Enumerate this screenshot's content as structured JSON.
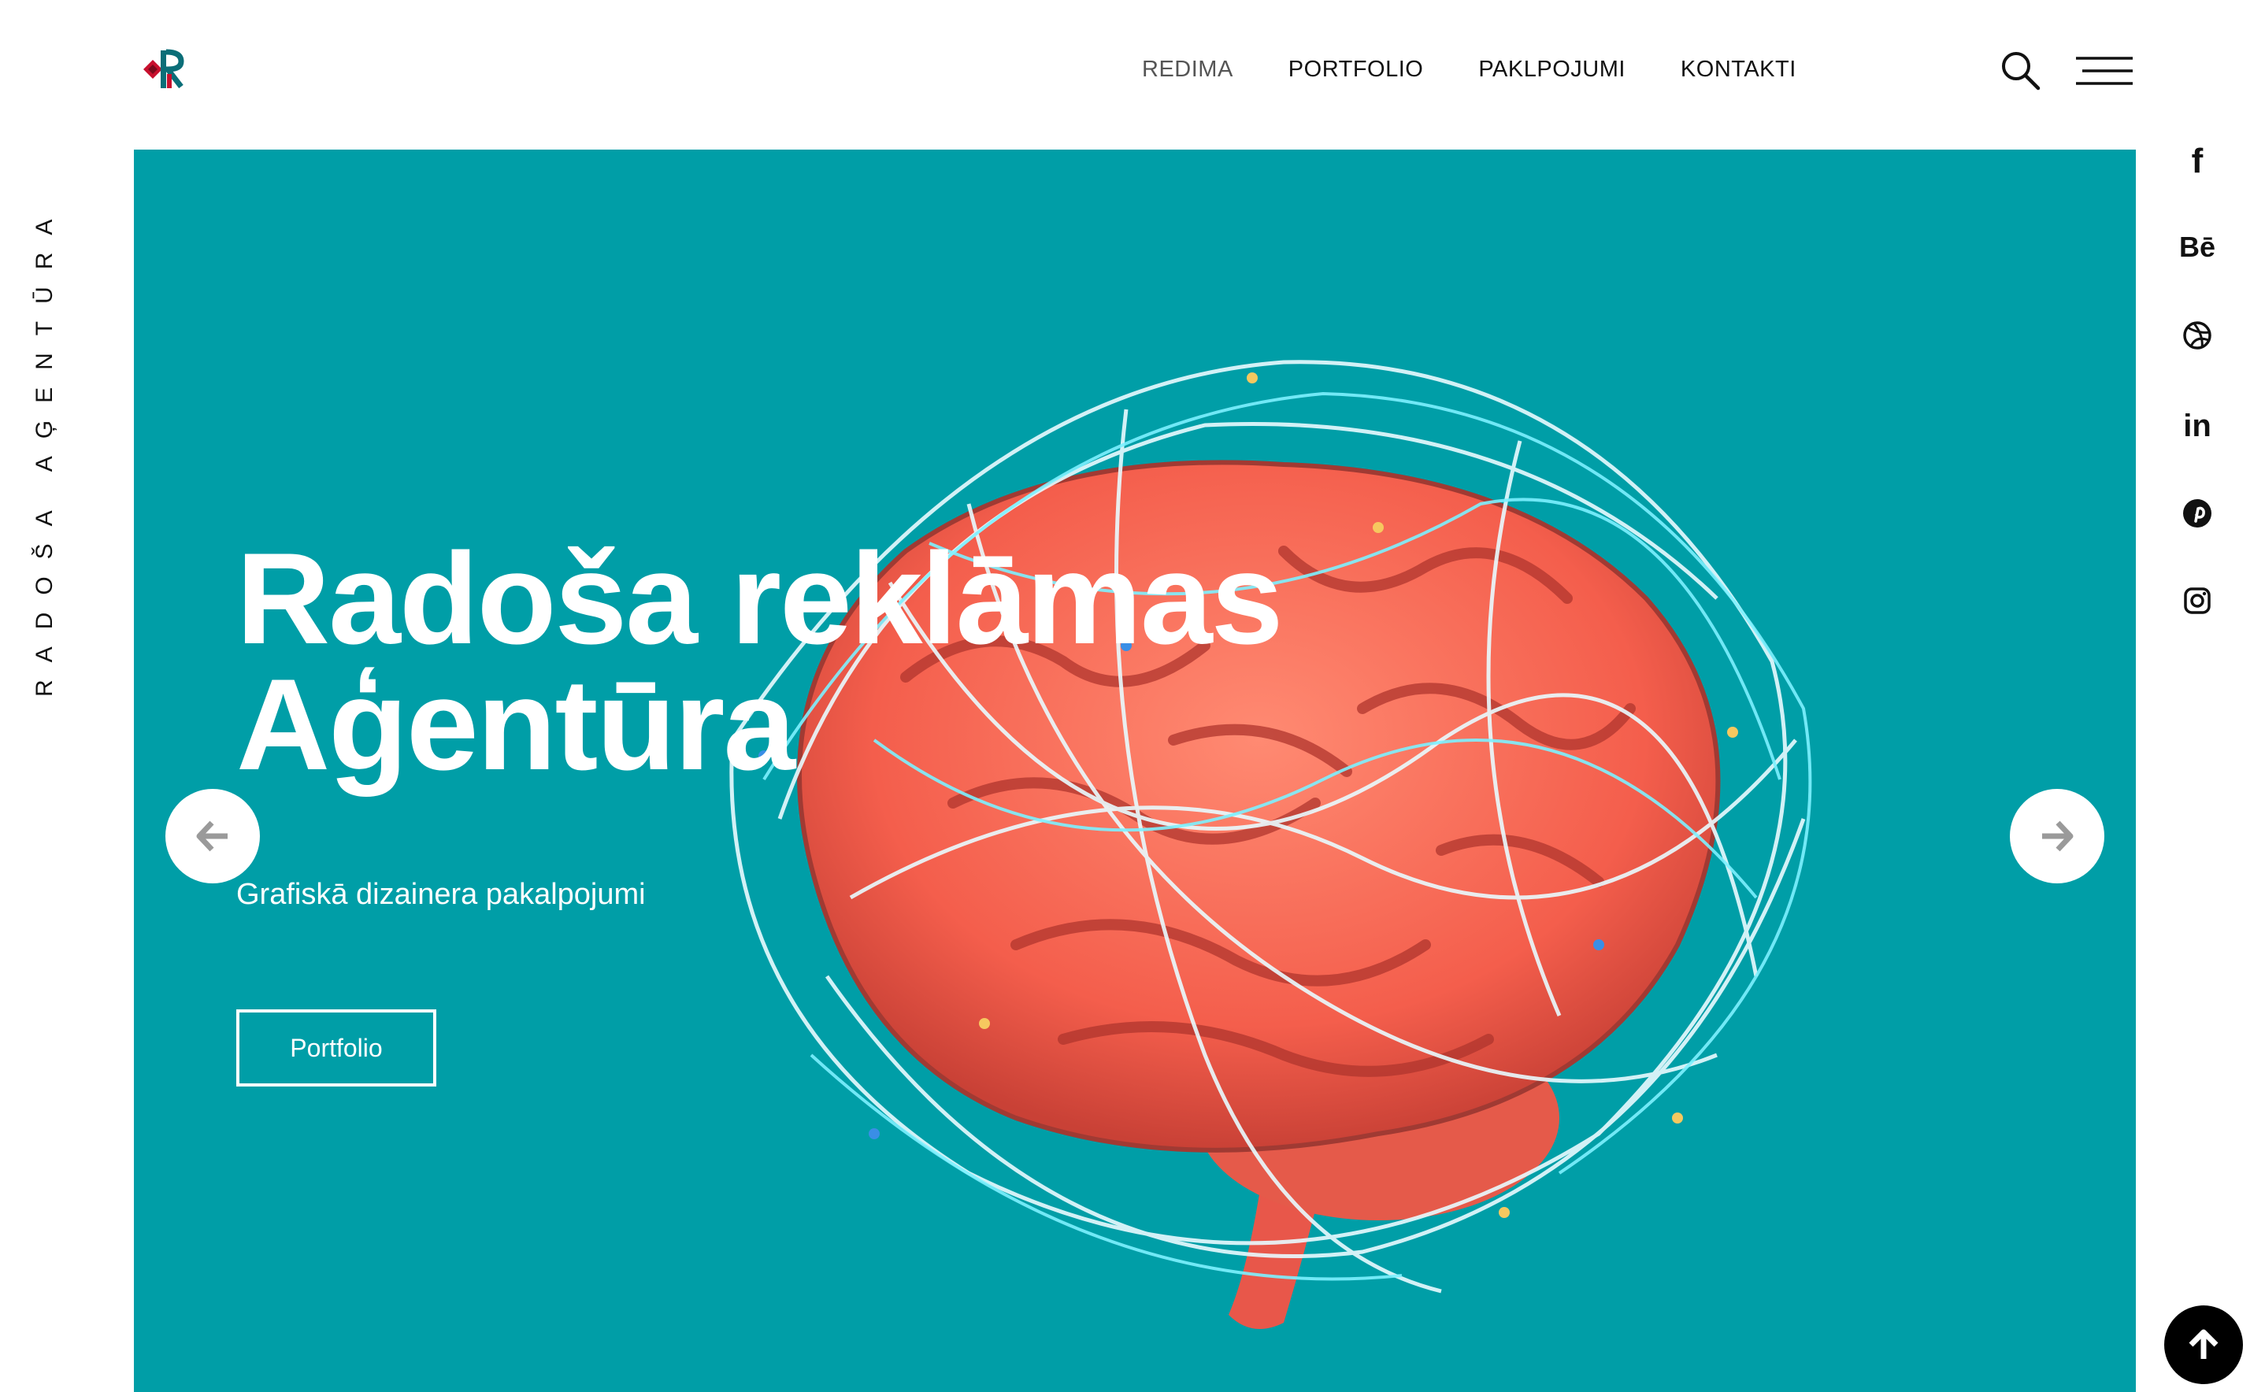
{
  "header": {
    "logo_alt": "R logo",
    "nav": [
      {
        "label": "REDIMA",
        "active": true
      },
      {
        "label": "PORTFOLIO"
      },
      {
        "label": "PAKLPOJUMI"
      },
      {
        "label": "KONTAKTI"
      }
    ],
    "search_icon": "search-icon",
    "menu_icon": "hamburger-menu-icon"
  },
  "sidebar": {
    "vertical_text": "RADOŠA AĢENTŪRA"
  },
  "hero": {
    "title_line1": "Radoša reklāmas",
    "title_line2": "Aģentūra",
    "subtitle": "Grafiskā dizainera pakalpojumi",
    "button_label": "Portfolio",
    "background_color": "#009ea7",
    "prev_icon": "arrow-left-icon",
    "next_icon": "arrow-right-icon"
  },
  "social": {
    "items": [
      {
        "name": "facebook-icon",
        "label": "f"
      },
      {
        "name": "behance-icon",
        "label": "Bē"
      },
      {
        "name": "dribbble-icon"
      },
      {
        "name": "linkedin-icon",
        "label": "in"
      },
      {
        "name": "pinterest-icon"
      },
      {
        "name": "instagram-icon"
      }
    ]
  },
  "back_to_top_icon": "arrow-up-icon"
}
